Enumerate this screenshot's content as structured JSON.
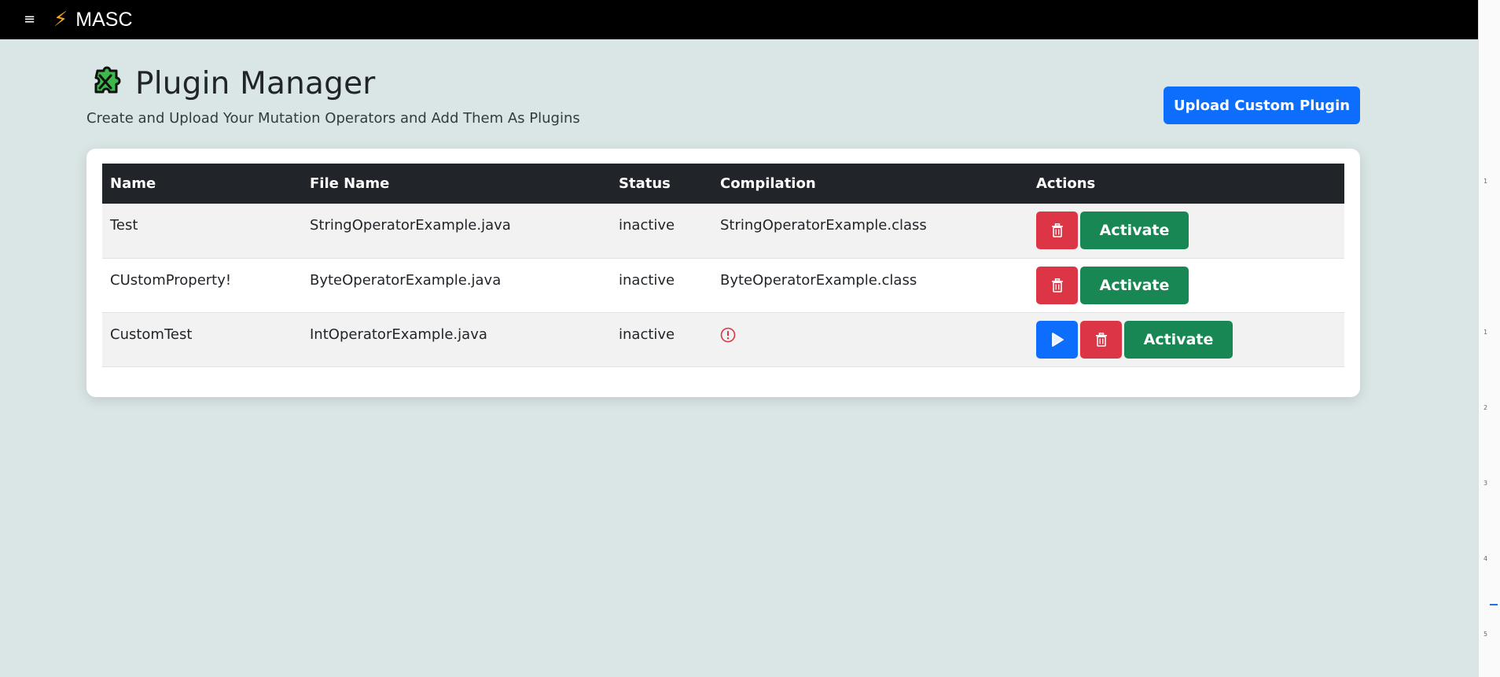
{
  "topbar": {
    "menu_glyph": "≡",
    "bolt_glyph": "⚡",
    "brand": "MASC"
  },
  "header": {
    "title": "Plugin Manager",
    "subtitle": "Create and Upload Your Mutation Operators and Add Them As Plugins",
    "icon": "puzzle-icon",
    "upload_label": "Upload Custom Plugin"
  },
  "table": {
    "columns": [
      "Name",
      "File Name",
      "Status",
      "Compilation",
      "Actions"
    ],
    "rows": [
      {
        "name": "Test",
        "file": "StringOperatorExample.java",
        "status": "inactive",
        "compilation": "StringOperatorExample.class",
        "activate_label": "Activate"
      },
      {
        "name": "CUstomProperty!",
        "file": "ByteOperatorExample.java",
        "status": "inactive",
        "compilation": "ByteOperatorExample.class",
        "activate_label": "Activate"
      },
      {
        "name": "CustomTest",
        "file": "IntOperatorExample.java",
        "status": "inactive",
        "compilation": "",
        "activate_label": "Activate"
      }
    ]
  },
  "ruler": {
    "ticks": [
      "1",
      "1",
      "2",
      "3",
      "4",
      "5"
    ]
  },
  "colors": {
    "background": "#dae6e5",
    "primary": "#0d6efd",
    "danger": "#dc3545",
    "success": "#198754",
    "table_header": "#212529"
  }
}
